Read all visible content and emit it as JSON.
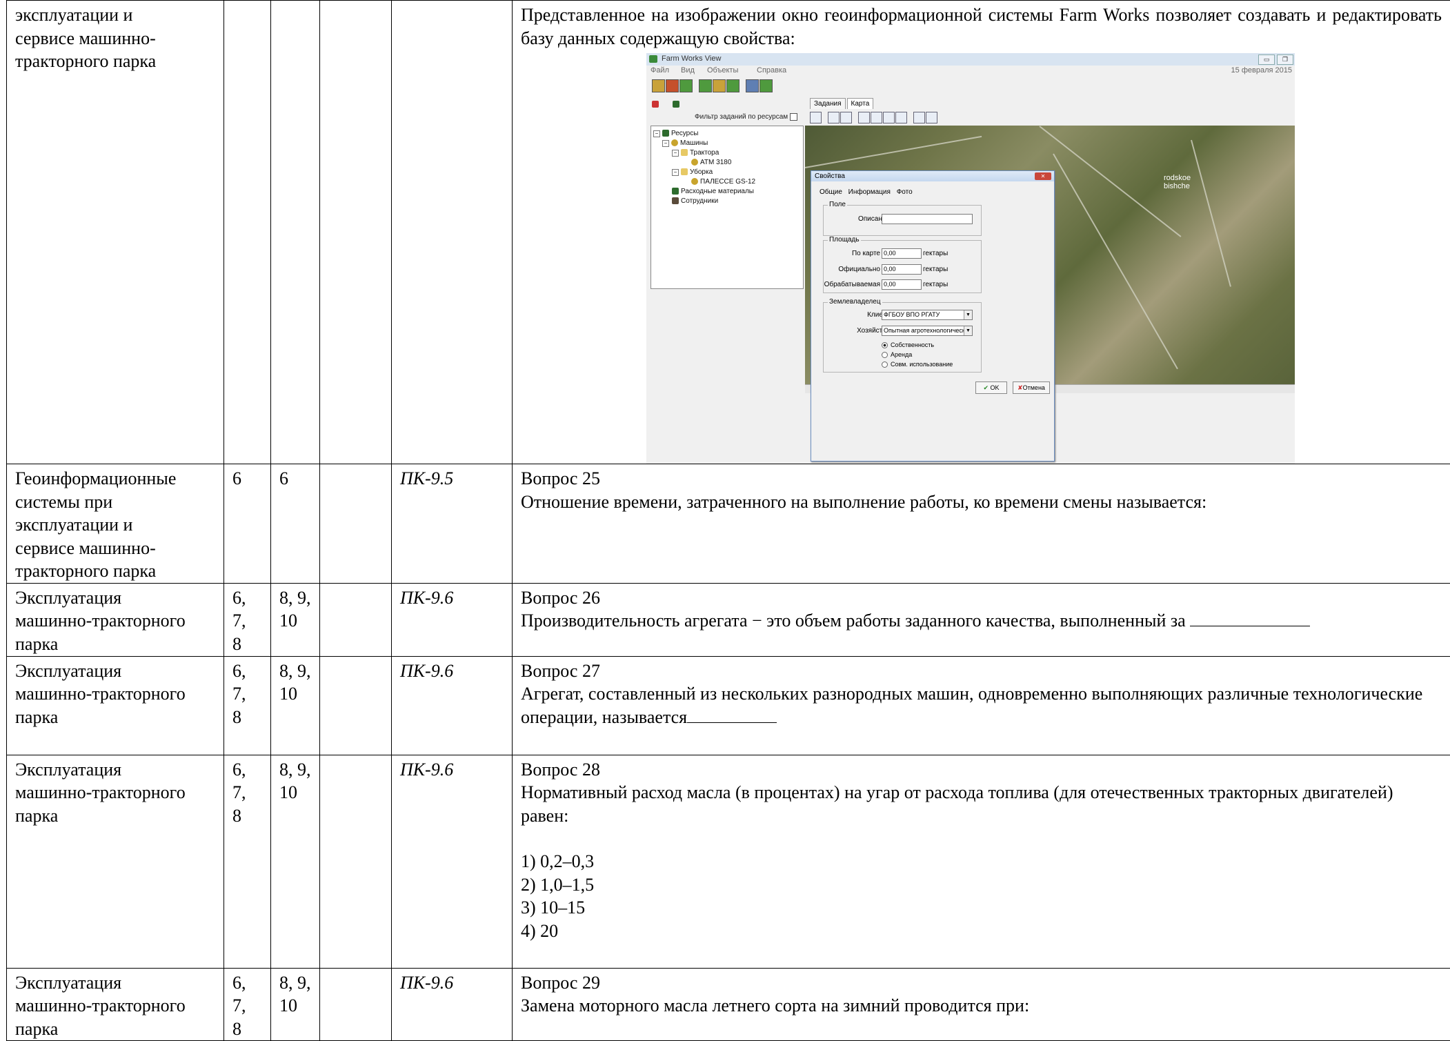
{
  "rows": [
    {
      "topic_lines": [
        "эксплуатации и",
        "сервисе машинно-",
        "тракторного парка"
      ],
      "c2": "",
      "c3": "",
      "c4": "",
      "comp": "",
      "text": "Представленное на изображении окно геоинформационной системы Farm Works позволяет создавать и редактировать базу данных содержащую свойства:"
    },
    {
      "topic_lines": [
        "Геоинформационные",
        "системы при",
        "эксплуатации и",
        "сервисе машинно-",
        "тракторного парка"
      ],
      "c2": "6",
      "c3": "6",
      "c4": "",
      "comp": "ПК-9.5",
      "q": "Вопрос 25",
      "text": "Отношение времени, затраченного на выполнение работы, ко времени смены называется:"
    },
    {
      "topic_lines": [
        "Эксплуатация",
        "машинно-тракторного",
        "парка"
      ],
      "c2_lines": [
        "6, 7,",
        "8"
      ],
      "c3_lines": [
        "8, 9,",
        "10"
      ],
      "c4": "",
      "comp": "ПК-9.6",
      "q": "Вопрос 26",
      "text": "Производительность агрегата − это объем работы заданного качества, выполненный за"
    },
    {
      "topic_lines": [
        "Эксплуатация",
        "машинно-тракторного",
        "парка"
      ],
      "c2_lines": [
        "6, 7,",
        "8"
      ],
      "c3_lines": [
        "8, 9,",
        "10"
      ],
      "c4": "",
      "comp": "ПК-9.6",
      "q": "Вопрос 27",
      "text": "Агрегат, составленный из нескольких разнородных машин, одновременно выполняющих различные технологические операции, называется"
    },
    {
      "topic_lines": [
        "Эксплуатация",
        "машинно-тракторного",
        "парка"
      ],
      "c2_lines": [
        "6, 7,",
        "8"
      ],
      "c3_lines": [
        "8, 9,",
        "10"
      ],
      "c4": "",
      "comp": "ПК-9.6",
      "q": "Вопрос 28",
      "text": "Нормативный расход масла (в процентах) на угар от расхода топлива (для отечественных тракторных двигателей) равен:",
      "options": [
        "1) 0,2–0,3",
        "2) 1,0–1,5",
        "3) 10–15",
        "4) 20"
      ]
    },
    {
      "topic_lines": [
        "Эксплуатация",
        "машинно-тракторного",
        "парка"
      ],
      "c2_lines": [
        "6, 7,",
        "8"
      ],
      "c3_lines": [
        "8, 9,",
        "10"
      ],
      "c4": "",
      "comp": "ПК-9.6",
      "q": "Вопрос 29",
      "text": "Замена моторного масла летнего сорта на зимний проводится при:"
    }
  ],
  "screenshot": {
    "title": "Farm Works View",
    "menu": [
      "Файл",
      "Вид",
      "Объекты",
      "Справка"
    ],
    "date": "15 февраля 2015",
    "filter_label": "Фильтр заданий по ресурсам",
    "tree": [
      "Ресурсы",
      "Машины",
      "Трактора",
      "ATM 3180",
      "Уборка",
      "ПАЛЕССЕ GS-12",
      "Расходные материалы",
      "Сотрудники"
    ],
    "tabs": [
      "Задания",
      "Карта"
    ],
    "map_label": [
      "rodskoe",
      "bishche"
    ],
    "dialog": {
      "title": "Свойства",
      "tabs": [
        "Общие",
        "Информация",
        "Фото"
      ],
      "group_field": "Поле",
      "description_label": "Описание",
      "group_area": "Площадь",
      "area_rows": [
        {
          "label": "По карте",
          "value": "0,00",
          "unit": "гектары"
        },
        {
          "label": "Официально",
          "value": "0,00",
          "unit": "гектары"
        },
        {
          "label": "Обрабатываемая",
          "value": "0,00",
          "unit": "гектары"
        }
      ],
      "group_owner": "Землевладелец",
      "client_label": "Клиент",
      "client_value": "ФГБОУ ВПО РГАТУ",
      "farm_label": "Хозяйство",
      "farm_value": "Опытная агротехнологическая ст",
      "ownership": [
        "Собственность",
        "Аренда",
        "Совм. использование"
      ],
      "ok": "OK",
      "cancel": "Отмена"
    }
  }
}
